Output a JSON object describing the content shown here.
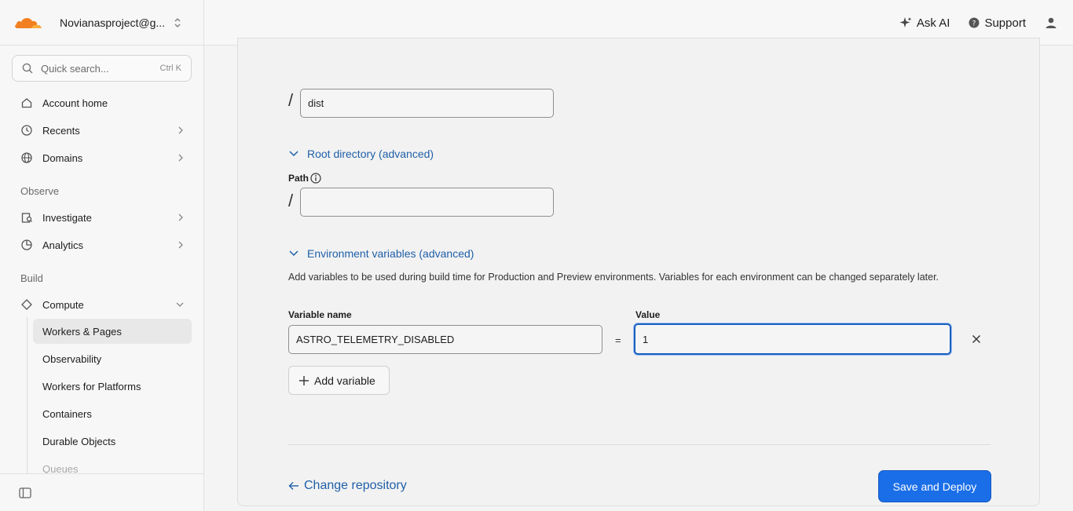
{
  "header": {
    "account_name": "Novianasproject@g...",
    "ask_ai_label": "Ask AI",
    "support_label": "Support"
  },
  "sidebar": {
    "search_placeholder": "Quick search...",
    "search_shortcut": "Ctrl K",
    "top_items": [
      {
        "label": "Account home",
        "icon": "home-icon"
      },
      {
        "label": "Recents",
        "icon": "clock-icon"
      },
      {
        "label": "Domains",
        "icon": "globe-icon"
      }
    ],
    "sections": {
      "observe": "Observe",
      "build": "Build"
    },
    "observe_items": [
      {
        "label": "Investigate",
        "icon": "investigate-icon"
      },
      {
        "label": "Analytics",
        "icon": "analytics-icon"
      }
    ],
    "compute_label": "Compute",
    "compute_sub_items": [
      "Workers & Pages",
      "Observability",
      "Workers for Platforms",
      "Containers",
      "Durable Objects",
      "Queues"
    ]
  },
  "form": {
    "output_dir_value": "dist",
    "root_dir_toggle": "Root directory (advanced)",
    "path_label": "Path",
    "path_value": "",
    "env_toggle": "Environment variables (advanced)",
    "env_help": "Add variables to be used during build time for Production and Preview environments. Variables for each environment can be changed separately later.",
    "variable_name_label": "Variable name",
    "value_label": "Value",
    "variable_name_value": "ASTRO_TELEMETRY_DISABLED",
    "variable_value": "1",
    "equals": "=",
    "add_variable_label": "Add variable",
    "back_label": "Change repository",
    "save_deploy_label": "Save and Deploy",
    "slash": "/"
  },
  "colors": {
    "accent": "#1a6ee8",
    "link": "#1f5fa8",
    "logo_orange": "#f38020"
  }
}
